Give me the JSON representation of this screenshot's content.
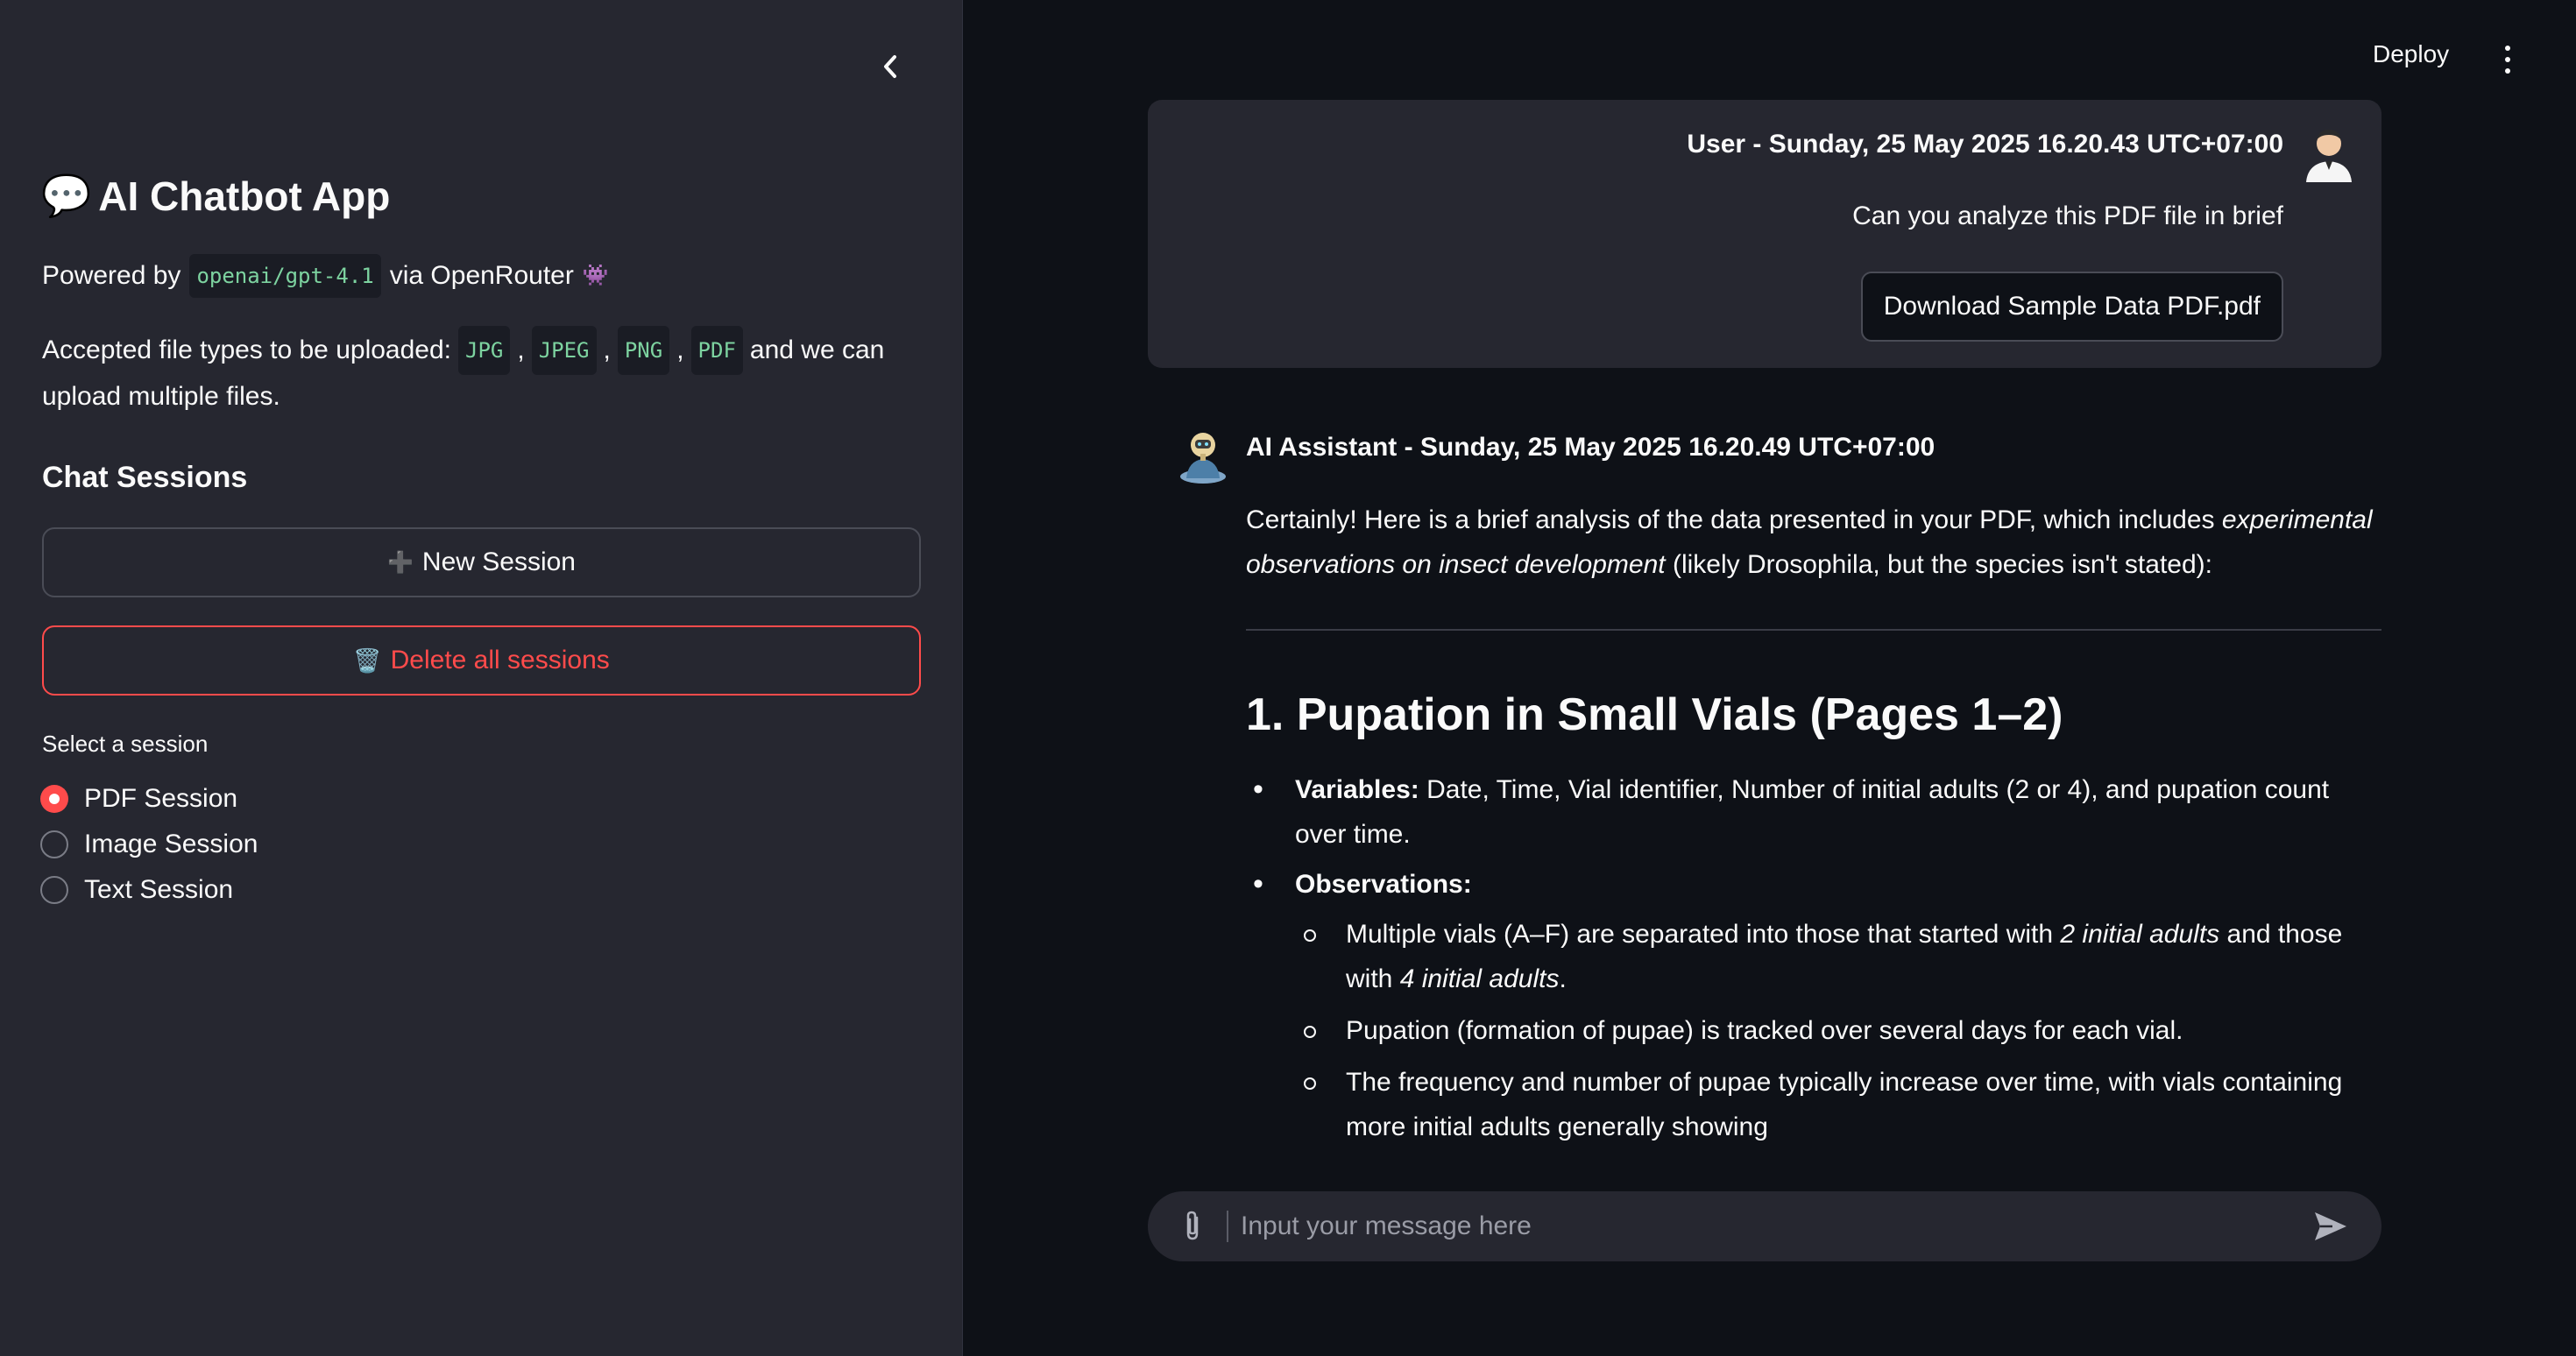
{
  "sidebar": {
    "title_emoji": "💬",
    "title": "AI Chatbot App",
    "powered_prefix": "Powered by",
    "model": "openai/gpt-4.1",
    "powered_suffix": "via OpenRouter",
    "powered_emoji": "👾",
    "accepted_prefix": "Accepted file types to be uploaded:",
    "file_types": [
      "JPG",
      "JPEG",
      "PNG",
      "PDF"
    ],
    "accepted_suffix": "and we can",
    "accepted_line2": "upload multiple files.",
    "sessions_heading": "Chat Sessions",
    "new_session_icon": "➕",
    "new_session_label": "New Session",
    "delete_icon": "🗑️",
    "delete_label": "Delete all sessions",
    "select_label": "Select a session",
    "sessions": [
      "PDF Session",
      "Image Session",
      "Text Session"
    ],
    "selected_session": "PDF Session"
  },
  "toolbar": {
    "deploy_label": "Deploy"
  },
  "user_message": {
    "header": "User - Sunday, 25 May 2025 16.20.43 UTC+07:00",
    "text": "Can you analyze this PDF file in brief",
    "download_label": "Download Sample Data PDF.pdf"
  },
  "assistant_message": {
    "header": "AI Assistant - Sunday, 25 May 2025 16.20.49 UTC+07:00",
    "intro_a": "Certainly! Here is a brief analysis of the data presented in your PDF, which includes ",
    "intro_em": "experimental observations on insect development",
    "intro_b": " (likely Drosophila, but the species isn't stated):",
    "section_heading": "1. Pupation in Small Vials (Pages 1–2)",
    "variables_label": "Variables:",
    "variables_text": " Date, Time, Vial identifier, Number of initial adults (2 or 4), and pupation count over time.",
    "observations_label": "Observations:",
    "obs1_a": "Multiple vials (A–F) are separated into those that started with ",
    "obs1_em1": "2 initial adults",
    "obs1_b": " and those with ",
    "obs1_em2": "4 initial adults",
    "obs1_c": ".",
    "obs2": "Pupation (formation of pupae) is tracked over several days for each vial.",
    "obs3": "The frequency and number of pupae typically increase over time, with vials containing more initial adults generally showing"
  },
  "chat_input": {
    "placeholder": "Input your message here",
    "value": ""
  },
  "colors": {
    "accent": "#ff4b4b",
    "sidebar_bg": "#262730",
    "main_bg": "#0e1117",
    "code_fg": "#7dd3a0"
  }
}
